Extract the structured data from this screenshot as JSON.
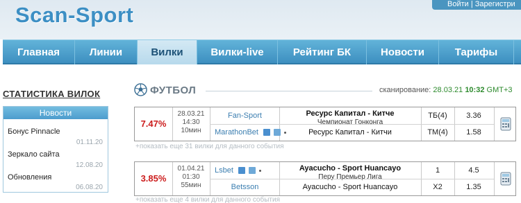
{
  "header": {
    "logo": "Scan-Sport",
    "auth_text": "Войти | Зарегистри"
  },
  "nav": [
    {
      "label": "Главная"
    },
    {
      "label": "Линии"
    },
    {
      "label": "Вилки"
    },
    {
      "label": "Вилки-live"
    },
    {
      "label": "Рейтинг БК"
    },
    {
      "label": "Новости"
    },
    {
      "label": "Тарифы"
    }
  ],
  "sidebar": {
    "stats_title": "СТАТИСТИКА ВИЛОК",
    "news_title": "Новости",
    "news": [
      {
        "title": "Бонус Pinnacle",
        "date": "01.11.20"
      },
      {
        "title": "Зеркало сайта",
        "date": "12.08.20"
      },
      {
        "title": "Обновления",
        "date": "06.08.20"
      }
    ]
  },
  "main": {
    "sport_title": "ФУТБОЛ",
    "scan_label": "сканирование:",
    "scan_date": "28.03.21",
    "scan_time": "10:32",
    "scan_tz": "GMT+3"
  },
  "forks": [
    {
      "percent": "7.47%",
      "date": "28.03.21",
      "time": "14:30",
      "duration": "10мин",
      "rows": [
        {
          "bookmaker": "Fan-Sport",
          "event": "Ресурс Капитал - Китче",
          "event_sub": "Чемпионат Гонконга",
          "bet": "ТБ(4)",
          "odd": "3.36"
        },
        {
          "bookmaker": "MarathonBet",
          "event": "Ресурс Капитал - Китчи",
          "bet": "ТМ(4)",
          "odd": "1.58"
        }
      ],
      "more": "+показать еще 31 вилки для данного события"
    },
    {
      "percent": "3.85%",
      "date": "01.04.21",
      "time": "01:30",
      "duration": "55мин",
      "rows": [
        {
          "bookmaker": "Lsbet",
          "event": "Ayacucho - Sport Huancayo",
          "event_sub": "Перу Премьер Лига",
          "bet": "1",
          "odd": "4.5"
        },
        {
          "bookmaker": "Betsson",
          "event": "Ayacucho - Sport Huancayo",
          "bet": "X2",
          "odd": "1.35"
        }
      ],
      "more": "+показать еще 4 вилки для данного события"
    }
  ],
  "colors": {
    "accent": "#3d8fc0",
    "percent": "#cc1d1d",
    "scan_time": "#2d8a2d"
  },
  "icons": [
    "soccer-ball-icon",
    "calculator-icon",
    "external-link-icon",
    "copy-icon"
  ]
}
